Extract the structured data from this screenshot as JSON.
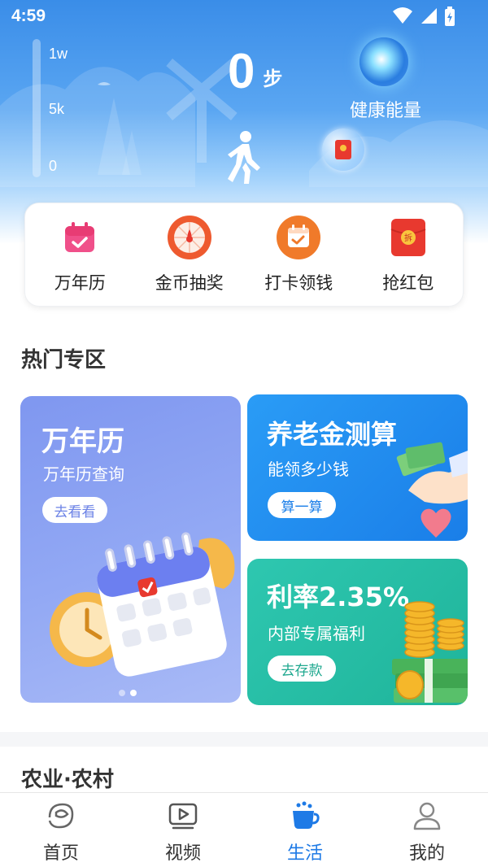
{
  "status_bar": {
    "time": "4:59",
    "icons": [
      "wifi-icon",
      "signal-icon",
      "battery-icon"
    ]
  },
  "hero": {
    "scale_labels": [
      "1w",
      "5k",
      "0"
    ],
    "step_count": "0",
    "step_unit": "步",
    "energy_label": "健康能量",
    "progress_fraction": 0
  },
  "quick_actions": [
    {
      "label": "万年历",
      "icon": "calendar-icon"
    },
    {
      "label": "金币抽奖",
      "icon": "lottery-wheel-icon"
    },
    {
      "label": "打卡领钱",
      "icon": "checkin-calendar-icon"
    },
    {
      "label": "抢红包",
      "icon": "red-envelope-icon"
    }
  ],
  "hot_section": {
    "title": "热门专区",
    "calendar_card": {
      "title": "万年历",
      "subtitle": "万年历查询",
      "button": "去看看"
    },
    "pension_card": {
      "title": "养老金测算",
      "subtitle": "能领多少钱",
      "button": "算一算"
    },
    "rate_card": {
      "title": "利率2.35%",
      "subtitle": "内部专属福利",
      "button": "去存款"
    },
    "carousel_dots": 2,
    "carousel_active": 2
  },
  "agri_section": {
    "title": "农业·农村"
  },
  "tabbar": [
    {
      "label": "首页",
      "icon": "home-icon",
      "active": false
    },
    {
      "label": "视频",
      "icon": "video-icon",
      "active": false
    },
    {
      "label": "生活",
      "icon": "life-cup-icon",
      "active": true
    },
    {
      "label": "我的",
      "icon": "profile-icon",
      "active": false
    }
  ],
  "colors": {
    "accent": "#1e7ae6",
    "calendar_card": "#8ea4f3",
    "pension_card": "#1f8cf0",
    "rate_card": "#27c4a8",
    "red": "#e8392f",
    "orange": "#f07a2a"
  }
}
